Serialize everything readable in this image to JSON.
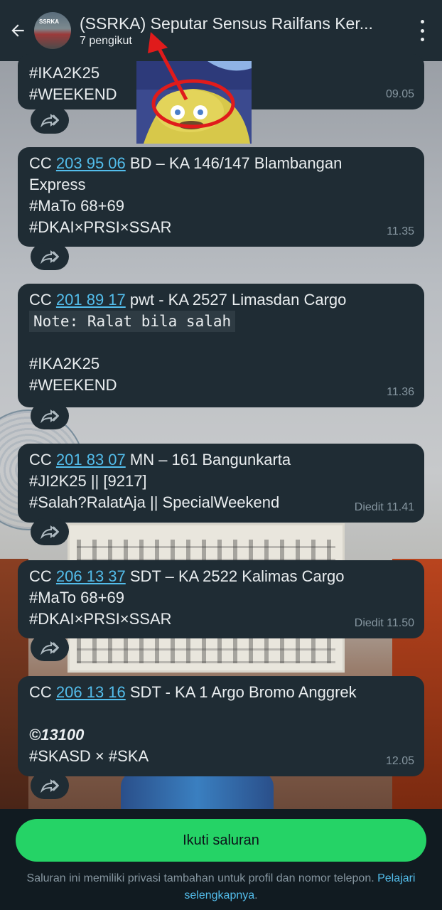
{
  "header": {
    "title": "(SSRKA) Seputar Sensus Railfans Ker...",
    "followers": "7 pengikut",
    "avatar_text": "SSRKA"
  },
  "messages": [
    {
      "lines": [
        {
          "text": "#IKA2K25"
        },
        {
          "text": "#WEEKEND"
        }
      ],
      "time": "09.05"
    },
    {
      "prefix": "CC ",
      "link": "203 95 06",
      "suffix": " BD – KA 146/147 Blambangan",
      "lines": [
        {
          "text": "Express"
        },
        {
          "text": "#MaTo 68+69"
        },
        {
          "text": "#DKAI×PRSI×SSAR"
        }
      ],
      "time": "11.35"
    },
    {
      "prefix": "CC ",
      "link": "201 89 17",
      "suffix": " pwt - KA 2527 Limasdan Cargo",
      "note": "Note: Ralat bila salah",
      "lines": [
        {
          "text": ""
        },
        {
          "text": "#IKA2K25"
        },
        {
          "text": "#WEEKEND"
        }
      ],
      "time": "11.36"
    },
    {
      "prefix": "CC ",
      "link": "201 83 07",
      "suffix": "  MN – 161 Bangunkarta",
      "lines": [
        {
          "text": "#JI2K25 || [9217]"
        },
        {
          "text": "#Salah?RalatAja || SpecialWeekend"
        }
      ],
      "time": "Diedit 11.41"
    },
    {
      "prefix": "CC ",
      "link": "206 13 37",
      "suffix": " SDT – KA 2522 Kalimas Cargo",
      "lines": [
        {
          "text": "#MaTo 68+69"
        },
        {
          "text": "#DKAI×PRSI×SSAR"
        }
      ],
      "time": "Diedit 11.50"
    },
    {
      "prefix": "CC ",
      "link": "206 13 16",
      "suffix": " SDT - KA 1 Argo Bromo Anggrek",
      "lines": [
        {
          "text": ""
        },
        {
          "text": "©13100"
        },
        {
          "text": "#SKASD × #SKA"
        }
      ],
      "time": "12.05"
    }
  ],
  "bottom": {
    "follow_label": "Ikuti saluran",
    "privacy_text": "Saluran ini memiliki privasi tambahan untuk profil dan nomor telepon.",
    "learn_more": "Pelajari selengkapnya",
    "learn_more_suffix": "."
  },
  "icons": {
    "back": "arrow-left-icon",
    "menu": "more-vertical-icon",
    "forward": "forward-icon"
  },
  "colors": {
    "accent_green": "#25d366",
    "link_blue": "#53bdeb",
    "bubble": "#1f2c34",
    "header": "#1f2c34"
  }
}
